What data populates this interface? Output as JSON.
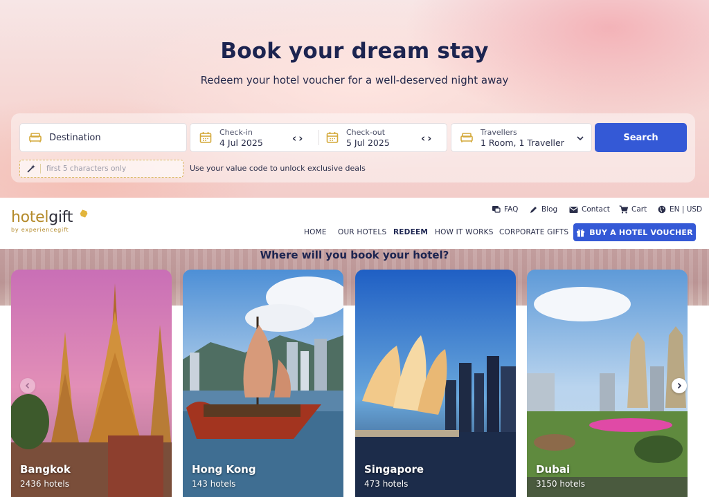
{
  "hero": {
    "title": "Book your dream stay",
    "subtitle": "Redeem your hotel voucher for a well-deserved night away"
  },
  "search": {
    "destination_placeholder": "Destination",
    "checkin": {
      "label": "Check-in",
      "value": "4 Jul 2025"
    },
    "checkout": {
      "label": "Check-out",
      "value": "5 Jul 2025"
    },
    "travellers": {
      "label": "Travellers",
      "value": "1 Room, 1 Traveller"
    },
    "button_label": "Search",
    "code_placeholder": "first 5 characters only",
    "code_note": "Use your value code to unlock exclusive deals"
  },
  "brand": {
    "logo_part1": "hotel",
    "logo_part2": "gift",
    "logo_by": "by experiencegift",
    "accent": "#3459d6",
    "gold": "#b48a2a"
  },
  "utility_nav": [
    {
      "label": "FAQ",
      "icon": "chat-icon"
    },
    {
      "label": "Blog",
      "icon": "pencil-icon"
    },
    {
      "label": "Contact",
      "icon": "mail-icon"
    },
    {
      "label": "Cart",
      "icon": "cart-icon"
    },
    {
      "label": "EN | USD",
      "icon": "globe-icon"
    }
  ],
  "main_nav": [
    {
      "label": "HOME"
    },
    {
      "label": "OUR HOTELS"
    },
    {
      "label": "REDEEM",
      "active": true
    },
    {
      "label": "HOW IT WORKS"
    },
    {
      "label": "CORPORATE GIFTS"
    }
  ],
  "buy_button": "BUY A HOTEL VOUCHER",
  "destinations": {
    "title": "Where will you book your hotel?",
    "cards": [
      {
        "city": "Bangkok",
        "hotels": "2436 hotels"
      },
      {
        "city": "Hong Kong",
        "hotels": "143 hotels"
      },
      {
        "city": "Singapore",
        "hotels": "473 hotels"
      },
      {
        "city": "Dubai",
        "hotels": "3150 hotels"
      }
    ]
  }
}
